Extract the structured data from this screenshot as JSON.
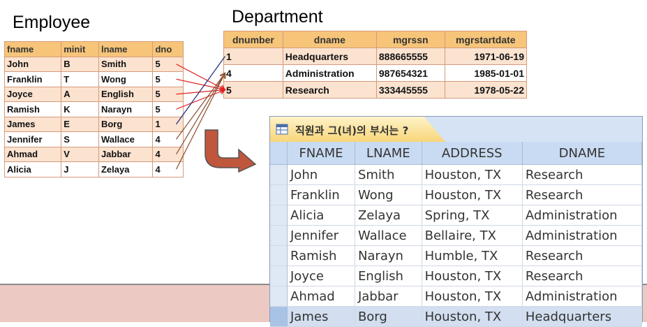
{
  "employee": {
    "title": "Employee",
    "columns": [
      "fname",
      "minit",
      "lname",
      "dno"
    ],
    "rows": [
      [
        "John",
        "B",
        "Smith",
        "5"
      ],
      [
        "Franklin",
        "T",
        "Wong",
        "5"
      ],
      [
        "Joyce",
        "A",
        "English",
        "5"
      ],
      [
        "Ramish",
        "K",
        "Narayn",
        "5"
      ],
      [
        "James",
        "E",
        "Borg",
        "1"
      ],
      [
        "Jennifer",
        "S",
        "Wallace",
        "4"
      ],
      [
        "Ahmad",
        "V",
        "Jabbar",
        "4"
      ],
      [
        "Alicia",
        "J",
        "Zelaya",
        "4"
      ]
    ]
  },
  "department": {
    "title": "Department",
    "columns": [
      "dnumber",
      "dname",
      "mgrssn",
      "mgrstartdate"
    ],
    "rows": [
      [
        "1",
        "Headquarters",
        "888665555",
        "1971-06-19"
      ],
      [
        "4",
        "Administration",
        "987654321",
        "1985-01-01"
      ],
      [
        "5",
        "Research",
        "333445555",
        "1978-05-22"
      ]
    ]
  },
  "result": {
    "tab_label": "직원과 그(녀)의 부서는 ?",
    "columns": [
      "FNAME",
      "LNAME",
      "ADDRESS",
      "DNAME"
    ],
    "rows": [
      [
        "John",
        "Smith",
        "Houston, TX",
        "Research"
      ],
      [
        "Franklin",
        "Wong",
        "Houston, TX",
        "Research"
      ],
      [
        "Alicia",
        "Zelaya",
        "Spring, TX",
        "Administration"
      ],
      [
        "Jennifer",
        "Wallace",
        "Bellaire, TX",
        "Administration"
      ],
      [
        "Ramish",
        "Narayn",
        "Humble, TX",
        "Research"
      ],
      [
        "Joyce",
        "English",
        "Houston, TX",
        "Research"
      ],
      [
        "Ahmad",
        "Jabbar",
        "Houston, TX",
        "Administration"
      ],
      [
        "James",
        "Borg",
        "Houston, TX",
        "Headquarters"
      ]
    ],
    "active_row": 7
  },
  "colors": {
    "header_orange": "#f6c57a",
    "row_peach": "#fbe3d0",
    "link_red": "#e02020",
    "link_brown": "#8a4a2a",
    "link_navy": "#1a2a7a",
    "arrow_fill": "#c0563c",
    "result_header": "#c9dbf2",
    "bottom_band": "#ecc9c3"
  }
}
